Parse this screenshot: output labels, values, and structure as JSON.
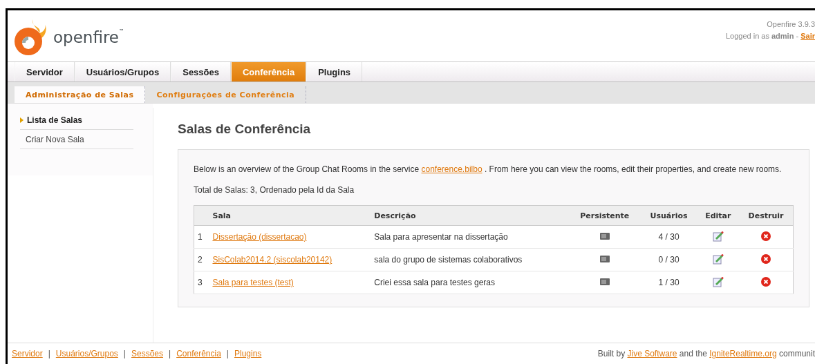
{
  "header": {
    "logo_text": "openfire",
    "trademark": "™",
    "version": "Openfire 3.9.3",
    "login_prefix": "Logged in as",
    "user": "admin",
    "separator": "-",
    "logout": "Sair"
  },
  "tabs": [
    {
      "label": "Servidor",
      "selected": false
    },
    {
      "label": "Usuários/Grupos",
      "selected": false
    },
    {
      "label": "Sessões",
      "selected": false
    },
    {
      "label": "Conferência",
      "selected": true
    },
    {
      "label": "Plugins",
      "selected": false
    }
  ],
  "subtabs": [
    {
      "label": "Administração de Salas",
      "selected": true
    },
    {
      "label": "Configurações de Conferência",
      "selected": false
    }
  ],
  "sidebar": {
    "items": [
      {
        "label": "Lista de Salas",
        "selected": true
      },
      {
        "label": "Criar Nova Sala",
        "selected": false
      }
    ]
  },
  "title": "Salas de Conferência",
  "intro": {
    "before": "Below is an overview of the Group Chat Rooms in the service",
    "link": "conference.bilbo",
    "after": ". From here you can view the rooms, edit their properties, and create new rooms."
  },
  "summary": "Total de Salas: 3, Ordenado pela Id da Sala",
  "table": {
    "columns": [
      "Sala",
      "Descrição",
      "Persistente",
      "Usuários",
      "Editar",
      "Destruir"
    ],
    "rows": [
      {
        "index": "1",
        "name": "Dissertação (dissertacao)",
        "description": "Sala para apresentar na dissertação",
        "persistent": true,
        "users": "4 / 30"
      },
      {
        "index": "2",
        "name": "SisColab2014.2 (siscolab20142)",
        "description": "sala do grupo de sistemas colaborativos",
        "persistent": true,
        "users": "0 / 30"
      },
      {
        "index": "3",
        "name": "Sala para testes (test)",
        "description": "Criei essa sala para testes geras",
        "persistent": true,
        "users": "1 / 30"
      }
    ]
  },
  "footer": {
    "links": [
      "Servidor",
      "Usuários/Grupos",
      "Sessões",
      "Conferência",
      "Plugins"
    ],
    "separator": "|",
    "credit": {
      "before": "Built by",
      "link1": "Jive Software",
      "middle": "and the",
      "link2": "IgniteRealtime.org",
      "after": "communit"
    }
  }
}
